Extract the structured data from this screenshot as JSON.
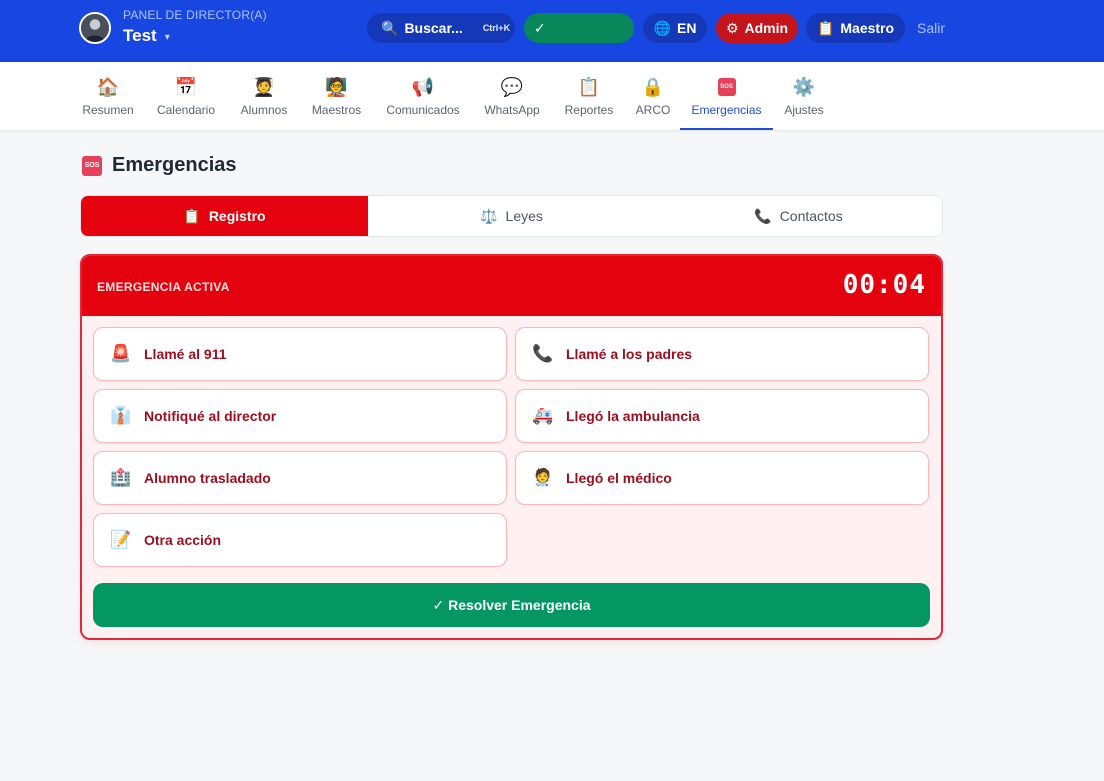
{
  "header": {
    "subtitle": "PANEL DE DIRECTOR(A)",
    "school_name": "Test",
    "caret_icon": "▾",
    "search": {
      "icon": "🔍",
      "label": "Buscar...",
      "shortcut": "Ctrl+K"
    },
    "status": {
      "icon": "✓"
    },
    "language": {
      "icon": "🌐",
      "label": "EN"
    },
    "admin": {
      "icon": "⚙",
      "label": "Admin"
    },
    "teacher": {
      "icon": "📋",
      "label": "Maestro"
    },
    "logout": "Salir"
  },
  "nav": {
    "items": [
      {
        "icon": "🏠",
        "label": "Resumen"
      },
      {
        "icon": "📅",
        "label": "Calendario"
      },
      {
        "icon": "🧑‍🎓",
        "label": "Alumnos"
      },
      {
        "icon": "🧑‍🏫",
        "label": "Maestros"
      },
      {
        "icon": "📢",
        "label": "Comunicados"
      },
      {
        "icon": "💬",
        "label": "WhatsApp"
      },
      {
        "icon": "📋",
        "label": "Reportes"
      },
      {
        "icon": "🔒",
        "label": "ARCO"
      },
      {
        "icon": "SOS",
        "label": "Emergencias",
        "active": true
      },
      {
        "icon": "⚙️",
        "label": "Ajustes"
      }
    ]
  },
  "page": {
    "title": "Emergencias",
    "title_icon": "SOS"
  },
  "tabs": [
    {
      "icon": "📋",
      "label": "Registro",
      "active": true
    },
    {
      "icon": "⚖️",
      "label": "Leyes"
    },
    {
      "icon": "📞",
      "label": "Contactos"
    }
  ],
  "emergency": {
    "status_label": "EMERGENCIA ACTIVA",
    "timer": "00:04",
    "actions": [
      {
        "icon": "🚨",
        "label": "Llamé al 911"
      },
      {
        "icon": "📞",
        "label": "Llamé a los padres"
      },
      {
        "icon": "👔",
        "label": "Notifiqué al director"
      },
      {
        "icon": "🚑",
        "label": "Llegó la ambulancia"
      },
      {
        "icon": "🏥",
        "label": "Alumno trasladado"
      },
      {
        "icon": "🧑‍⚕️",
        "label": "Llegó el médico"
      },
      {
        "icon": "📝",
        "label": "Otra acción"
      }
    ],
    "resolve_label": "✓ Resolver Emergencia"
  },
  "colors": {
    "topbar": "#1747e0",
    "emergency_red": "#e3020e",
    "resolve_green": "#049763",
    "active_nav": "#1d4ed8"
  }
}
